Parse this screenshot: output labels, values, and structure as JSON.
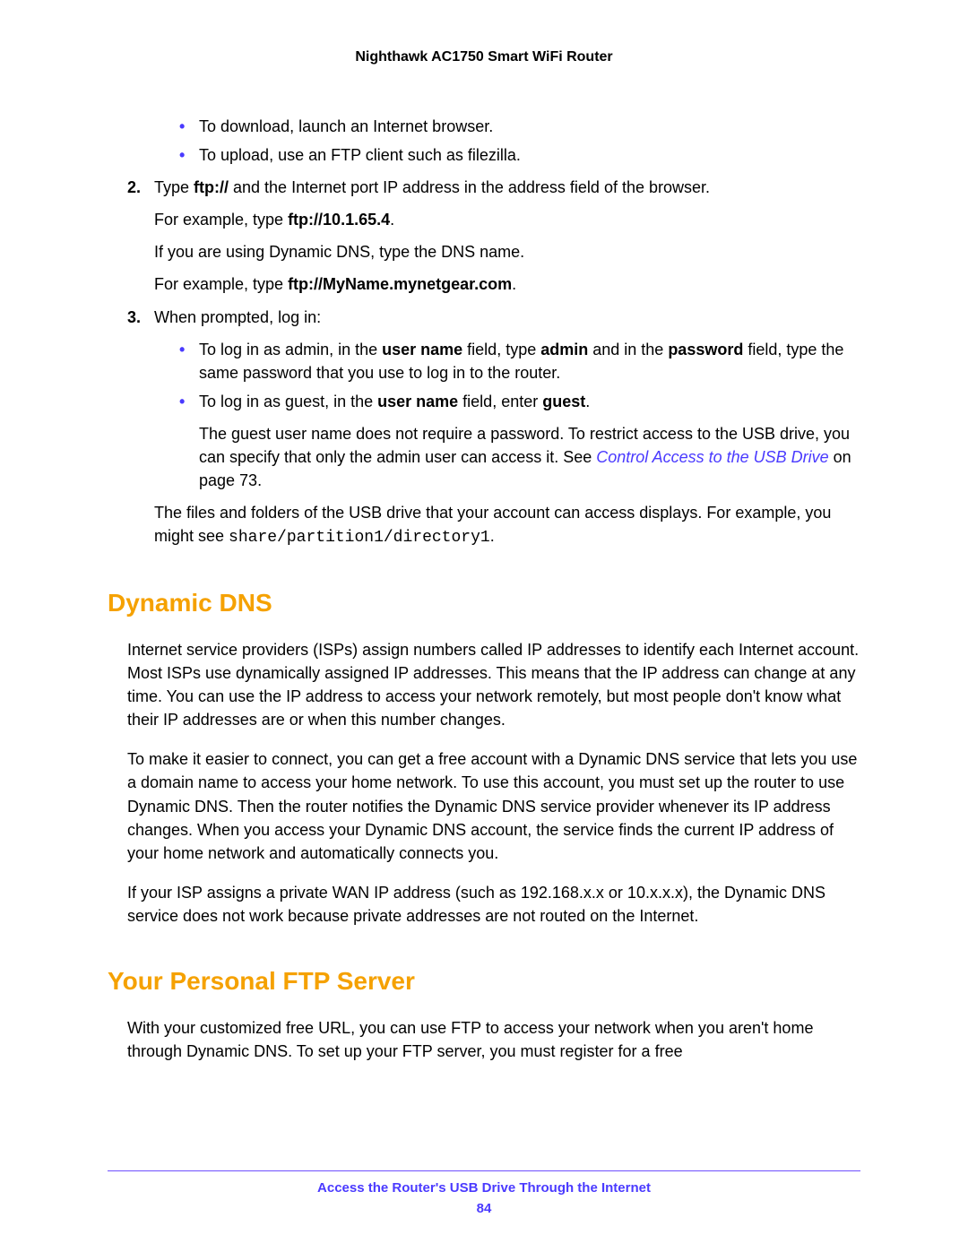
{
  "header": {
    "title": "Nighthawk AC1750 Smart WiFi Router"
  },
  "list1": {
    "b1": "To download, launch an Internet browser.",
    "b2": "To upload, use an FTP client such as filezilla."
  },
  "step2": {
    "num": "2.",
    "pre": "Type ",
    "bold1": "ftp://",
    "post": " and the Internet port IP address in the address field of the browser.",
    "ex1_pre": "For example, type ",
    "ex1_bold": "ftp://10.1.65.4",
    "ex1_post": ".",
    "dns": "If you are using Dynamic DNS, type the DNS name.",
    "ex2_pre": "For example, type ",
    "ex2_bold": "ftp://MyName.mynetgear.com",
    "ex2_post": "."
  },
  "step3": {
    "num": "3.",
    "text": "When prompted, log in:",
    "admin_pre": "To log in as admin, in the ",
    "admin_b1": "user name",
    "admin_mid1": " field, type ",
    "admin_b2": "admin",
    "admin_mid2": " and in the ",
    "admin_b3": "password",
    "admin_post": " field, type the same password that you use to log in to the router.",
    "guest_pre": "To log in as guest, in the ",
    "guest_b1": "user name",
    "guest_mid": " field, enter ",
    "guest_b2": "guest",
    "guest_post": ".",
    "guest_note_pre": "The guest user name does not require a password. To restrict access to the USB drive, you can specify that only the admin user can access it. See ",
    "guest_link": "Control Access to the USB Drive",
    "guest_note_post": " on page 73.",
    "files_pre": "The files and folders of the USB drive that your account can access displays. For example, you might see ",
    "files_mono": "share/partition1/directory1",
    "files_post": "."
  },
  "dyn": {
    "heading": "Dynamic DNS",
    "p1": "Internet service providers (ISPs) assign numbers called IP addresses to identify each Internet account. Most ISPs use dynamically assigned IP addresses. This means that the IP address can change at any time. You can use the IP address to access your network remotely, but most people don't know what their IP addresses are or when this number changes.",
    "p2": "To make it easier to connect, you can get a free account with a Dynamic DNS service that lets you use a domain name to access your home network. To use this account, you must set up the router to use Dynamic DNS. Then the router notifies the Dynamic DNS service provider whenever its IP address changes. When you access your Dynamic DNS account, the service finds the current IP address of your home network and automatically connects you.",
    "p3": "If your ISP assigns a private WAN IP address (such as 192.168.x.x or 10.x.x.x), the Dynamic DNS service does not work because private addresses are not routed on the Internet."
  },
  "ftp": {
    "heading": "Your Personal FTP Server",
    "p1": "With your customized free URL, you can use FTP to access your network when you aren't home through Dynamic DNS. To set up your FTP server, you must register for a free"
  },
  "footer": {
    "text": "Access the Router's USB Drive Through the Internet",
    "page": "84"
  }
}
